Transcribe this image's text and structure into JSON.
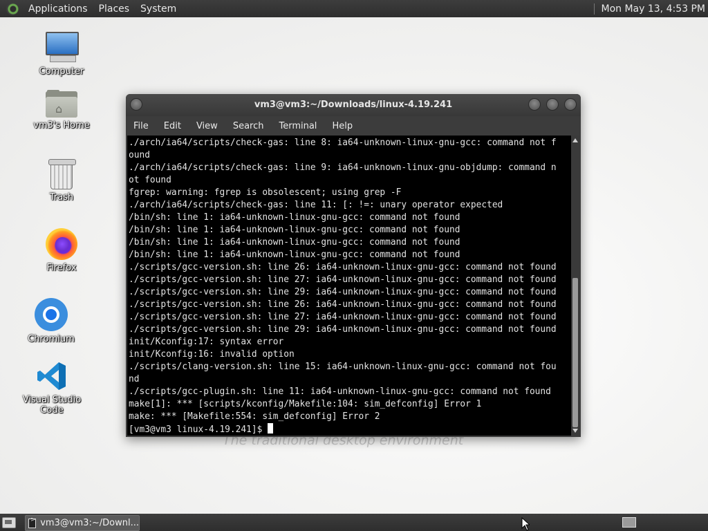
{
  "top_panel": {
    "menus": [
      "Applications",
      "Places",
      "System"
    ],
    "clock": "Mon May 13,  4:53 PM"
  },
  "desktop": {
    "background_text": "The traditional desktop environment",
    "icons": [
      {
        "label": "Computer",
        "icon": "computer-icon"
      },
      {
        "label": "vm3's Home",
        "icon": "home-folder-icon"
      },
      {
        "label": "Trash",
        "icon": "trash-icon"
      },
      {
        "label": "Firefox",
        "icon": "firefox-icon"
      },
      {
        "label": "Chromium",
        "icon": "chromium-icon"
      },
      {
        "label": "Visual Studio Code",
        "icon": "vscode-icon"
      }
    ]
  },
  "terminal": {
    "title": "vm3@vm3:~/Downloads/linux-4.19.241",
    "menu": [
      "File",
      "Edit",
      "View",
      "Search",
      "Terminal",
      "Help"
    ],
    "lines": [
      "./arch/ia64/scripts/check-gas: line 8: ia64-unknown-linux-gnu-gcc: command not f",
      "ound",
      "./arch/ia64/scripts/check-gas: line 9: ia64-unknown-linux-gnu-objdump: command n",
      "ot found",
      "fgrep: warning: fgrep is obsolescent; using grep -F",
      "./arch/ia64/scripts/check-gas: line 11: [: !=: unary operator expected",
      "/bin/sh: line 1: ia64-unknown-linux-gnu-gcc: command not found",
      "/bin/sh: line 1: ia64-unknown-linux-gnu-gcc: command not found",
      "/bin/sh: line 1: ia64-unknown-linux-gnu-gcc: command not found",
      "/bin/sh: line 1: ia64-unknown-linux-gnu-gcc: command not found",
      "./scripts/gcc-version.sh: line 26: ia64-unknown-linux-gnu-gcc: command not found",
      "./scripts/gcc-version.sh: line 27: ia64-unknown-linux-gnu-gcc: command not found",
      "./scripts/gcc-version.sh: line 29: ia64-unknown-linux-gnu-gcc: command not found",
      "./scripts/gcc-version.sh: line 26: ia64-unknown-linux-gnu-gcc: command not found",
      "./scripts/gcc-version.sh: line 27: ia64-unknown-linux-gnu-gcc: command not found",
      "./scripts/gcc-version.sh: line 29: ia64-unknown-linux-gnu-gcc: command not found",
      "init/Kconfig:17: syntax error",
      "init/Kconfig:16: invalid option",
      "./scripts/clang-version.sh: line 15: ia64-unknown-linux-gnu-gcc: command not fou",
      "nd",
      "./scripts/gcc-plugin.sh: line 11: ia64-unknown-linux-gnu-gcc: command not found",
      "make[1]: *** [scripts/kconfig/Makefile:104: sim_defconfig] Error 1",
      "make: *** [Makefile:554: sim_defconfig] Error 2"
    ],
    "prompt": "[vm3@vm3 linux-4.19.241]$ "
  },
  "bottom_panel": {
    "task_label": "vm3@vm3:~/Downl..."
  }
}
